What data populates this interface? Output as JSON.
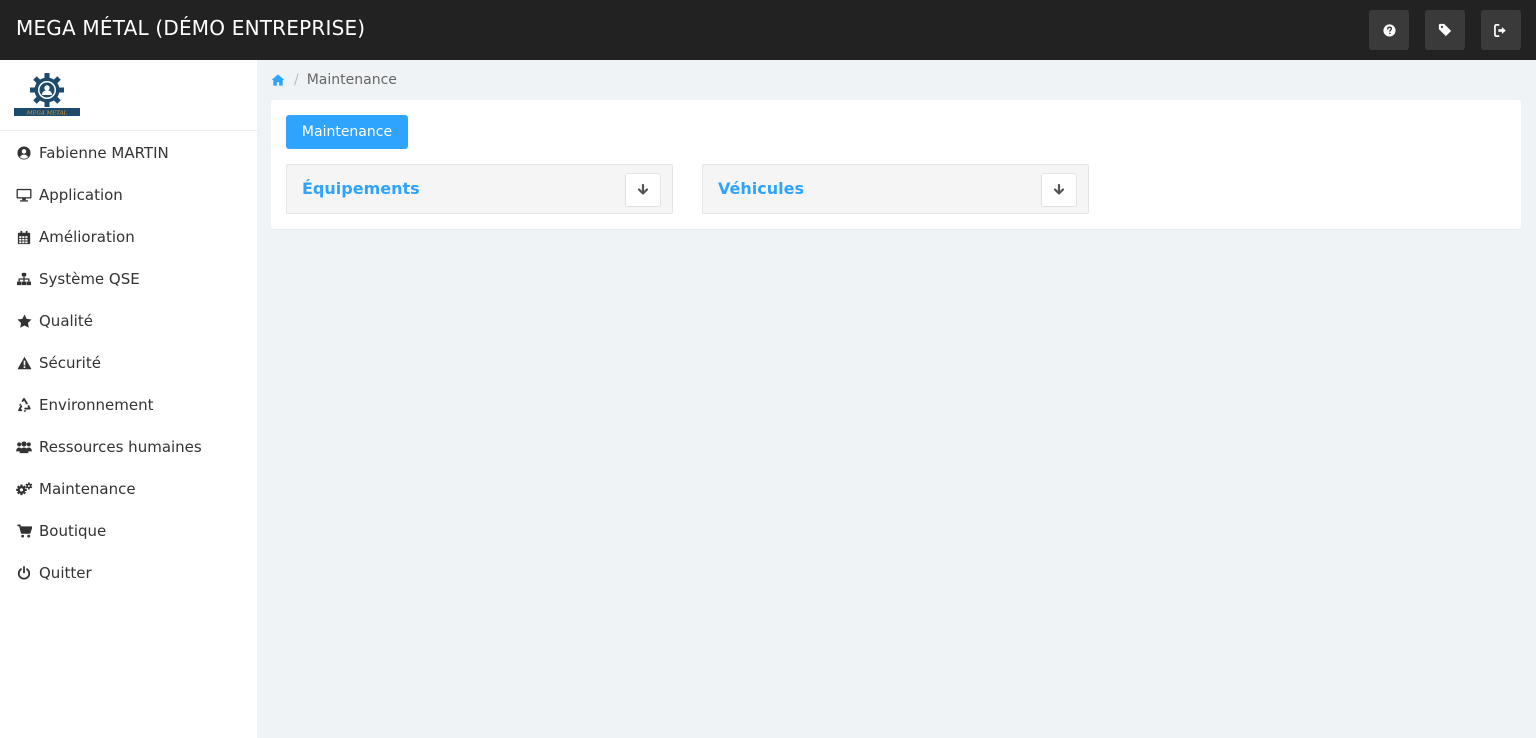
{
  "app": {
    "title": "MEGA MÉTAL (DÉMO ENTREPRISE)"
  },
  "logo": {
    "text": "MEGA METAL"
  },
  "topbar": {
    "buttons": [
      {
        "icon": "question-circle-icon"
      },
      {
        "icon": "tag-icon"
      },
      {
        "icon": "sign-out-icon"
      }
    ]
  },
  "sidebar": {
    "items": [
      {
        "label": "Fabienne MARTIN",
        "icon": "user-circle-icon"
      },
      {
        "label": "Application",
        "icon": "desktop-icon"
      },
      {
        "label": "Amélioration",
        "icon": "calendar-icon"
      },
      {
        "label": "Système QSE",
        "icon": "sitemap-icon"
      },
      {
        "label": "Qualité",
        "icon": "star-icon"
      },
      {
        "label": "Sécurité",
        "icon": "warning-icon"
      },
      {
        "label": "Environnement",
        "icon": "recycle-icon"
      },
      {
        "label": "Ressources humaines",
        "icon": "users-icon"
      },
      {
        "label": "Maintenance",
        "icon": "cogs-icon"
      },
      {
        "label": "Boutique",
        "icon": "shopping-cart-icon"
      },
      {
        "label": "Quitter",
        "icon": "power-off-icon"
      }
    ]
  },
  "breadcrumb": {
    "separator": "/",
    "current": "Maintenance"
  },
  "main": {
    "primary_button": "Maintenance",
    "cards": [
      {
        "title": "Équipements"
      },
      {
        "title": "Véhicules"
      }
    ]
  },
  "colors": {
    "topbar": "#222222",
    "accent": "#2fa4ff",
    "background": "#eff3f6",
    "icon": "#333333"
  }
}
